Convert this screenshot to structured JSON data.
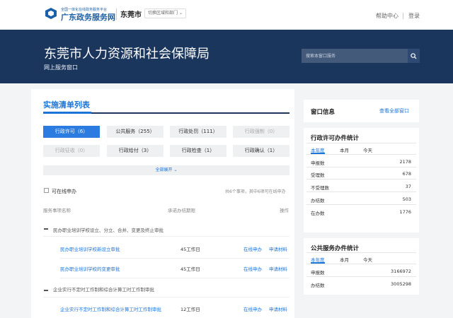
{
  "header": {
    "logo_subtitle": "全国一体化在线政务服务平台",
    "logo_title": "广东政务服务网",
    "city": "东莞市",
    "switch_label": "切换区域和部门",
    "help": "帮助中心",
    "login": "登录"
  },
  "banner": {
    "title": "东莞市人力资源和社会保障局",
    "subtitle": "网上服务窗口",
    "search_placeholder": "搜索本窗口服务"
  },
  "list": {
    "title": "实施清单列表",
    "filters": [
      {
        "label": "行政许可（6）"
      },
      {
        "label": "公共服务（255）"
      },
      {
        "label": "行政处罚（111）"
      },
      {
        "label": "行政强制（0）"
      },
      {
        "label": "行政征收（0）"
      },
      {
        "label": "行政给付（3）"
      },
      {
        "label": "行政检查（1）"
      },
      {
        "label": "行政确认（1）"
      }
    ],
    "expand_label": "全部展开",
    "online_only_label": "可在线申办",
    "count_note": "共6个事项，其中6项可在线申办",
    "columns": {
      "name": "服务事项名称",
      "time": "承诺办结期限",
      "action": "操作"
    },
    "groups": [
      {
        "name": "民办职业培训学校设立、分立、合并、变更及终止审批",
        "items": [
          {
            "name": "民办职业培训学校新设立审批",
            "time": "45工作日",
            "online": "在线申办",
            "apply": "申请材料"
          },
          {
            "name": "民办职业培训学校的变更审批",
            "time": "45工作日",
            "online": "在线申办",
            "apply": "申请材料"
          }
        ]
      },
      {
        "name": "企业实行不定时工作制和综合计算工时工作制审批",
        "items": [
          {
            "name": "企业实行不定时工作制和综合计算工时工作制审批",
            "time": "12工作日",
            "online": "在线申办",
            "apply": "申请材料"
          }
        ]
      }
    ]
  },
  "window_info": {
    "title": "窗口信息",
    "link": "查看全部窗口"
  },
  "permit_stats": {
    "title": "行政许可办件统计",
    "tabs": [
      "本年度",
      "本月",
      "今天"
    ],
    "rows": [
      {
        "label": "申报数",
        "value": "2178"
      },
      {
        "label": "受理数",
        "value": "678"
      },
      {
        "label": "不受理数",
        "value": "37"
      },
      {
        "label": "办结数",
        "value": "503"
      },
      {
        "label": "在办数",
        "value": "1776"
      }
    ]
  },
  "public_stats": {
    "title": "公共服务办件统计",
    "tabs": [
      "本年度",
      "本月",
      "今天"
    ],
    "rows": [
      {
        "label": "申报数",
        "value": "3166972"
      },
      {
        "label": "办结数",
        "value": "3005298"
      }
    ]
  },
  "colors": {
    "accent": "#1b74d8",
    "banner": "#1b365d",
    "active_filter": "#2b7be0"
  }
}
